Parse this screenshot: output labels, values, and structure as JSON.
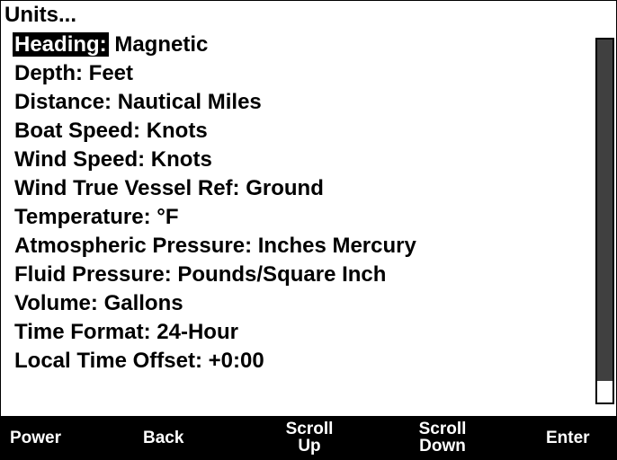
{
  "title": "Units...",
  "menu": {
    "items": [
      {
        "name": "Heading:",
        "value": "Magnetic",
        "selected": true
      },
      {
        "name": "Depth:",
        "value": "Feet",
        "selected": false
      },
      {
        "name": "Distance:",
        "value": "Nautical Miles",
        "selected": false
      },
      {
        "name": "Boat Speed:",
        "value": "Knots",
        "selected": false
      },
      {
        "name": "Wind Speed:",
        "value": "Knots",
        "selected": false
      },
      {
        "name": "Wind True Vessel Ref:",
        "value": "Ground",
        "selected": false
      },
      {
        "name": "Temperature:",
        "value": "°F",
        "selected": false
      },
      {
        "name": "Atmospheric Pressure:",
        "value": "Inches Mercury",
        "selected": false
      },
      {
        "name": "Fluid Pressure:",
        "value": "Pounds/Square Inch",
        "selected": false
      },
      {
        "name": "Volume:",
        "value": "Gallons",
        "selected": false
      },
      {
        "name": "Time Format:",
        "value": "24-Hour",
        "selected": false
      },
      {
        "name": "Local Time Offset:",
        "value": "+0:00",
        "selected": false
      }
    ]
  },
  "scrollbar": {
    "visible_fraction": 0.94,
    "position_fraction": 0.0,
    "thumb_color": "#404040"
  },
  "softkeys": {
    "power": "Power",
    "back": "Back",
    "scroll_up_line1": "Scroll",
    "scroll_up_line2": "Up",
    "scroll_down_line1": "Scroll",
    "scroll_down_line2": "Down",
    "enter": "Enter"
  }
}
